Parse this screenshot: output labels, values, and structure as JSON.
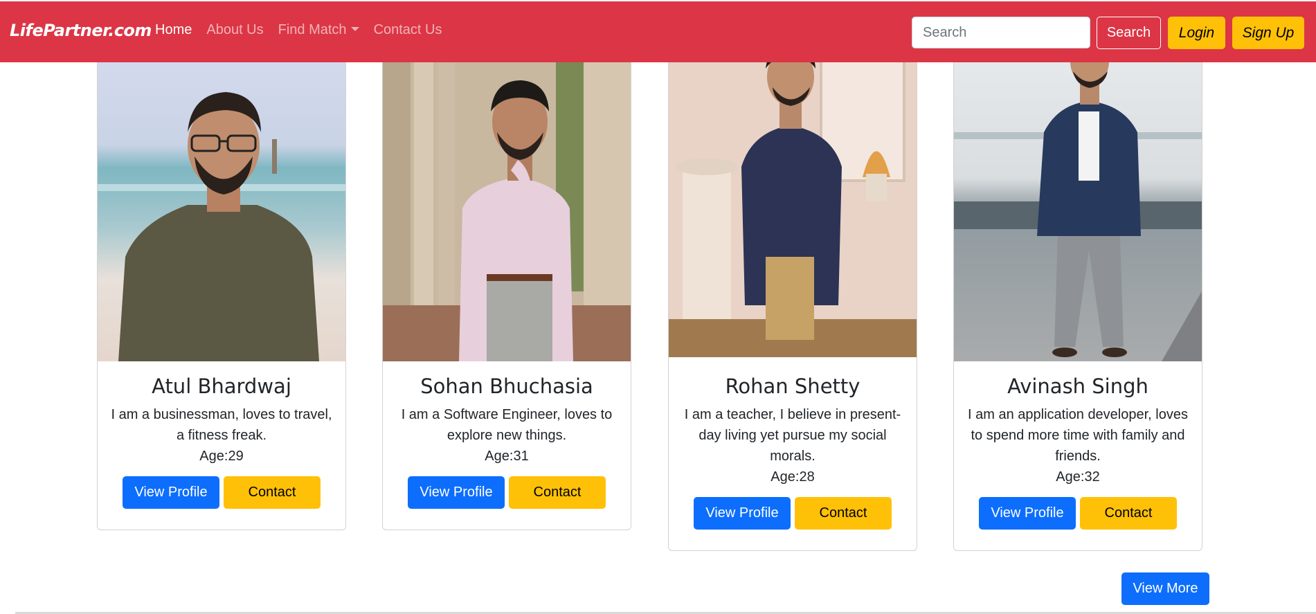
{
  "navbar": {
    "brand": "LifePartner.com",
    "links": [
      {
        "label": "Home",
        "active": true
      },
      {
        "label": "About Us",
        "active": false
      },
      {
        "label": "Find Match",
        "active": false,
        "dropdown": true
      },
      {
        "label": "Contact Us",
        "active": false
      }
    ],
    "search_placeholder": "Search",
    "search_button": "Search",
    "login": "Login",
    "signup": "Sign Up"
  },
  "profiles": [
    {
      "name": "Atul Bhardwaj",
      "bio": "I am a businessman, loves to travel, a fitness freak.",
      "age": "Age:29",
      "view_label": "View Profile",
      "contact_label": "Contact"
    },
    {
      "name": "Sohan Bhuchasia",
      "bio": "I am a Software Engineer, loves to explore new things.",
      "age": "Age:31",
      "view_label": "View Profile",
      "contact_label": "Contact"
    },
    {
      "name": "Rohan Shetty",
      "bio": "I am a teacher, I believe in present-day living yet pursue my social morals.",
      "age": "Age:28",
      "view_label": "View Profile",
      "contact_label": "Contact"
    },
    {
      "name": "Avinash Singh",
      "bio": "I am an application developer, loves to spend more time with family and friends.",
      "age": "Age:32",
      "view_label": "View Profile",
      "contact_label": "Contact"
    }
  ],
  "view_more": "View More",
  "colors": {
    "navbar": "#dc3545",
    "primary": "#0d6efd",
    "warning": "#ffc107"
  }
}
